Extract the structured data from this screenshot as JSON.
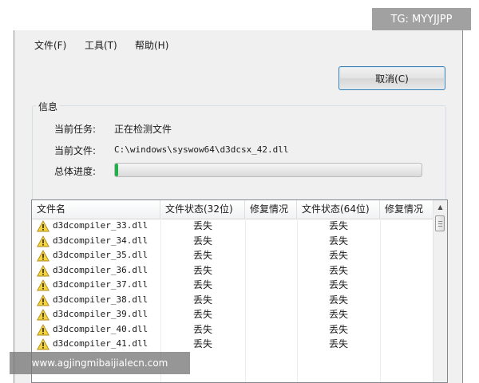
{
  "menu": {
    "file": "文件(F)",
    "tools": "工具(T)",
    "help": "帮助(H)"
  },
  "cancel_label": "取消(C)",
  "info": {
    "title": "信息",
    "task_label": "当前任务:",
    "task_value": "正在检测文件",
    "file_label": "当前文件:",
    "file_value": "C:\\windows\\syswow64\\d3dcsx_42.dll",
    "progress_label": "总体进度:",
    "progress": 0.01
  },
  "table": {
    "headers": [
      "文件名",
      "文件状态(32位)",
      "修复情况",
      "文件状态(64位)",
      "修复情况"
    ],
    "rows": [
      {
        "name": "d3dcompiler_33.dll",
        "s32": "丢失",
        "s64": "丢失"
      },
      {
        "name": "d3dcompiler_34.dll",
        "s32": "丢失",
        "s64": "丢失"
      },
      {
        "name": "d3dcompiler_35.dll",
        "s32": "丢失",
        "s64": "丢失"
      },
      {
        "name": "d3dcompiler_36.dll",
        "s32": "丢失",
        "s64": "丢失"
      },
      {
        "name": "d3dcompiler_37.dll",
        "s32": "丢失",
        "s64": "丢失"
      },
      {
        "name": "d3dcompiler_38.dll",
        "s32": "丢失",
        "s64": "丢失"
      },
      {
        "name": "d3dcompiler_39.dll",
        "s32": "丢失",
        "s64": "丢失"
      },
      {
        "name": "d3dcompiler_40.dll",
        "s32": "丢失",
        "s64": "丢失"
      },
      {
        "name": "d3dcompiler_41.dll",
        "s32": "丢失",
        "s64": "丢失"
      }
    ]
  },
  "watermarks": {
    "top": "TG: MYYJJPP",
    "bottom": "www.agjingmibaijialecn.com"
  },
  "icons": {
    "row_status": "warning-icon",
    "scroll_up": "scroll-up-arrow-icon"
  },
  "colors": {
    "progress_fill": "#23b04a",
    "warning_fill": "#f5d43b",
    "button_border": "#3c7fb1"
  }
}
